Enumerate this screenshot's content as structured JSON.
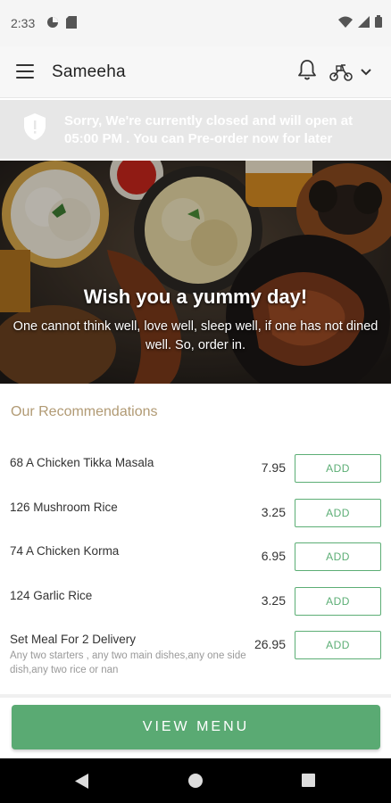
{
  "status_bar": {
    "time": "2:33"
  },
  "header": {
    "title": "Sameeha",
    "menu_icon": "hamburger-menu-icon",
    "bell_icon": "bell-icon",
    "delivery_icon": "scooter-icon"
  },
  "banner": {
    "text": "Sorry, We're currently closed and will open at 05:00 PM . You can Pre-order now for later"
  },
  "hero": {
    "title": "Wish you a yummy day!",
    "subtitle": "One cannot think well, love well, sleep well, if one has not dined well. So, order in."
  },
  "recommendations": {
    "heading": "Our Recommendations",
    "add_label": "ADD",
    "items": [
      {
        "name": "68 A Chicken Tikka Masala",
        "price": "7.95",
        "description": ""
      },
      {
        "name": "126 Mushroom Rice",
        "price": "3.25",
        "description": ""
      },
      {
        "name": "74 A Chicken Korma",
        "price": "6.95",
        "description": ""
      },
      {
        "name": "124 Garlic Rice",
        "price": "3.25",
        "description": ""
      },
      {
        "name": "Set Meal For 2 Delivery",
        "price": "26.95",
        "description": "Any two starters , any two main dishes,any one side dish,any two rice or nan"
      }
    ]
  },
  "footer": {
    "view_menu_label": "VIEW MENU"
  },
  "colors": {
    "accent_green": "#5aaa73",
    "heading_tan": "#b19a74",
    "banner_gray": "#e7e7e7"
  }
}
